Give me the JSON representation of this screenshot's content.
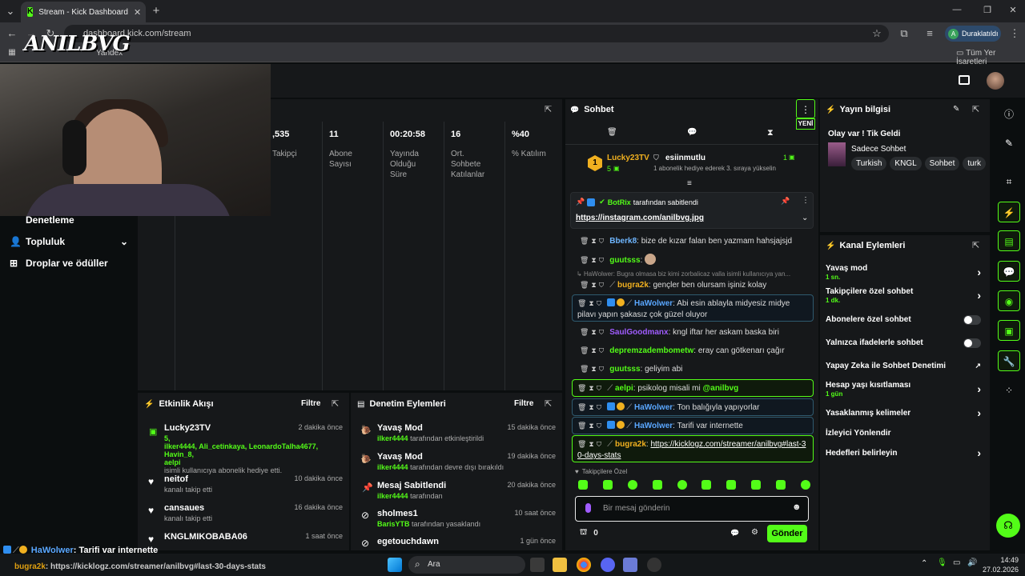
{
  "browser": {
    "tab_title": "Stream - Kick Dashboard",
    "url": "dashboard.kick.com/stream",
    "profile_label": "Duraklatıldı",
    "profile_initial": "A",
    "bookmarks": [
      "Yandex"
    ],
    "all_bookmarks": "Tüm Yer İşaretleri"
  },
  "streamer_logo": "ANILBVG",
  "left_nav": {
    "items": [
      {
        "label": "Denetleme"
      },
      {
        "label": "Topluluk"
      },
      {
        "label": "Droplar ve ödüller"
      }
    ]
  },
  "stats": [
    {
      "value": ",535",
      "label": "Takipçi"
    },
    {
      "value": "11",
      "label": "Abone Sayısı"
    },
    {
      "value": "00:20:58",
      "label": "Yayında Olduğu Süre"
    },
    {
      "value": "16",
      "label": "Ort. Sohbete Katılanlar"
    },
    {
      "value": "%40",
      "label": "% Katılım"
    }
  ],
  "activity": {
    "title": "Etkinlik Akışı",
    "filter": "Filtre",
    "items": [
      {
        "name": "Lucky23TV",
        "time": "2 dakika önce",
        "line1": "5,",
        "line2": "ilker4444, Ali_cetinkaya, LeonardoTalha4677, Havin_8,",
        "line3": "aelpi",
        "desc": "isimli kullanıcıya abonelik hediye etti."
      },
      {
        "name": "neitof",
        "time": "10 dakika önce",
        "desc": "kanalı takip etti"
      },
      {
        "name": "cansaues",
        "time": "16 dakika önce",
        "desc": "kanalı takip etti"
      },
      {
        "name": "KNGLMIKOBABA06",
        "time": "1 saat önce"
      }
    ]
  },
  "moderation": {
    "title": "Denetim Eylemleri",
    "filter": "Filtre",
    "items": [
      {
        "name": "Yavaş Mod",
        "time": "15 dakika önce",
        "user": "ilker4444",
        "desc": "tarafından etkinleştirildi"
      },
      {
        "name": "Yavaş Mod",
        "time": "19 dakika önce",
        "user": "ilker4444",
        "desc": "tarafından devre dışı bırakıldı"
      },
      {
        "name": "Mesaj Sabitlendi",
        "time": "20 dakika önce",
        "user": "ilker4444",
        "desc": "tarafından"
      },
      {
        "name": "sholmes1",
        "time": "10 saat önce",
        "user": "BarisYTB",
        "desc": "tarafından yasaklandı"
      },
      {
        "name": "egetouchdawn",
        "time": "1 gün önce"
      }
    ]
  },
  "chat": {
    "title": "Sohbet",
    "new_label": "YENİ",
    "leader": {
      "rank": "1",
      "name": "Lucky23TV",
      "count": "5",
      "gifter": "esiinmutlu",
      "gifter_count": "1",
      "gifter_desc": "1 abonelik hediye ederek 3. sıraya yükselin"
    },
    "pinned": {
      "author": "BotRix",
      "suffix": "tarafından sabitlendi",
      "link": "https://instagram.com/anilbvg.jpg"
    },
    "messages": [
      {
        "user": "Bberk8",
        "text": "bize de kızar falan ben yazmam hahsjajsjd"
      },
      {
        "user": "guutsss",
        "text": ""
      },
      {
        "reply": "HaWolwer: Bugra olmasa biz kimi zorbalicaz valla isimli kullanıcıya yan..."
      },
      {
        "user": "bugra2k",
        "text": "gençler ben olursam işiniz kolay"
      },
      {
        "user": "HaWolwer",
        "text": "Abi esin ablayla midyesiz midye pilavı yapın şakasız çok güzel oluyor"
      },
      {
        "user": "SaulGoodmanx",
        "text": "kngl iftar her askam baska biri"
      },
      {
        "user": "depremzadembometw",
        "text": "eray can götkenarı çağır"
      },
      {
        "user": "guutsss",
        "text": "geliyim abi"
      },
      {
        "user": "aelpi",
        "text": "psikolog misali mi",
        "mention": "@anilbvg"
      },
      {
        "user": "HaWolwer",
        "text": "Ton balığıyla yapıyorlar"
      },
      {
        "user": "HaWolwer",
        "text": "Tarifi var internette"
      },
      {
        "user": "bugra2k",
        "link": "https://kicklogz.com/streamer/anilbvg#last-30-days-stats"
      }
    ],
    "followers_only": "Takipçilere Özel",
    "input_placeholder": "Bir mesaj gönderin",
    "points": "0",
    "send": "Gönder"
  },
  "stream_info": {
    "title": "Yayın bilgisi",
    "stream_title": "Olay var ! Tik Geldi",
    "category": "Sadece Sohbet",
    "tags": [
      "Turkish",
      "KNGL",
      "Sohbet",
      "turk"
    ]
  },
  "channel_actions": {
    "title": "Kanal Eylemleri",
    "items": [
      {
        "label": "Yavaş mod",
        "sub": "1 sn."
      },
      {
        "label": "Takipçilere özel sohbet",
        "sub": "1 dk."
      },
      {
        "label": "Abonelere özel sohbet"
      },
      {
        "label": "Yalnızca ifadelerle sohbet"
      },
      {
        "label": "Yapay Zeka ile Sohbet Denetimi"
      },
      {
        "label": "Hesap yaşı kısıtlaması",
        "sub": "1 gün"
      },
      {
        "label": "Yasaklanmış kelimeler"
      },
      {
        "label": "İzleyici Yönlendir"
      },
      {
        "label": "Hedefleri belirleyin"
      }
    ]
  },
  "overlay": {
    "line1_user": "HaWolwer",
    "line1_text": ": Tarifi var internette",
    "line2_user": "bugra2k",
    "line2_text": ": https://kicklogz.com/streamer/anilbvg#last-30-days-stats"
  },
  "taskbar": {
    "search": "Ara",
    "time": "14:49",
    "date": "27.02.2026"
  },
  "colors": {
    "accent": "#53fc18",
    "panel": "#16181a",
    "background": "#0b0e0f"
  }
}
